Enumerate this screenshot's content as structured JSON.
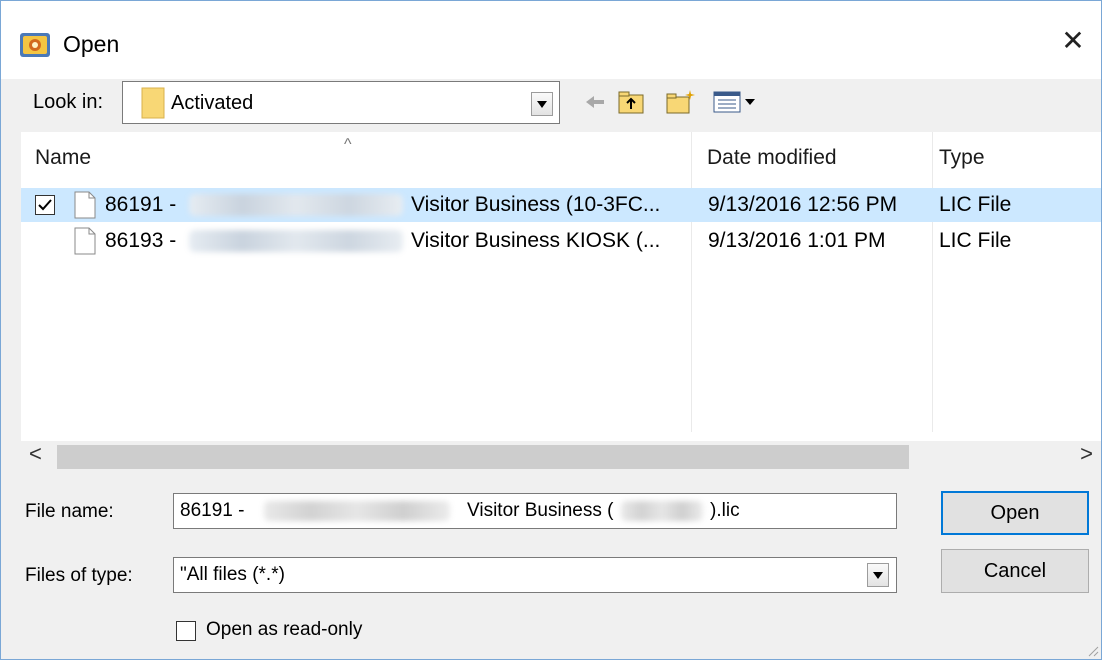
{
  "window": {
    "title": "Open",
    "close_glyph": "✕"
  },
  "lookin": {
    "label": "Look in:",
    "value": "Activated"
  },
  "toolbar_icons": [
    "back-arrow-icon",
    "up-one-level-icon",
    "new-folder-icon",
    "view-menu-icon"
  ],
  "columns": {
    "name": "Name",
    "date": "Date modified",
    "type": "Type"
  },
  "files": [
    {
      "id_prefix": "86191 -",
      "description": "Visitor Business (10-3FC...",
      "date": "9/13/2016 12:56 PM",
      "type": "LIC File",
      "selected": true,
      "checked": true
    },
    {
      "id_prefix": "86193 -",
      "description": "Visitor Business KIOSK (...",
      "date": "9/13/2016 1:01 PM",
      "type": "LIC File",
      "selected": false,
      "checked": false
    }
  ],
  "scroll": {
    "left_glyph": "<",
    "right_glyph": ">"
  },
  "filename": {
    "label": "File name:",
    "prefix": "86191 -",
    "middle": "Visitor Business (",
    "suffix": ").lic"
  },
  "filetype": {
    "label": "Files of type:",
    "value": "\"All files (*.*)"
  },
  "buttons": {
    "open": "Open",
    "cancel": "Cancel"
  },
  "readonly": {
    "label": "Open as read-only",
    "checked": false
  },
  "colors": {
    "selection": "#cce8ff",
    "accent": "#0078d7",
    "folder": "#f8d775"
  }
}
